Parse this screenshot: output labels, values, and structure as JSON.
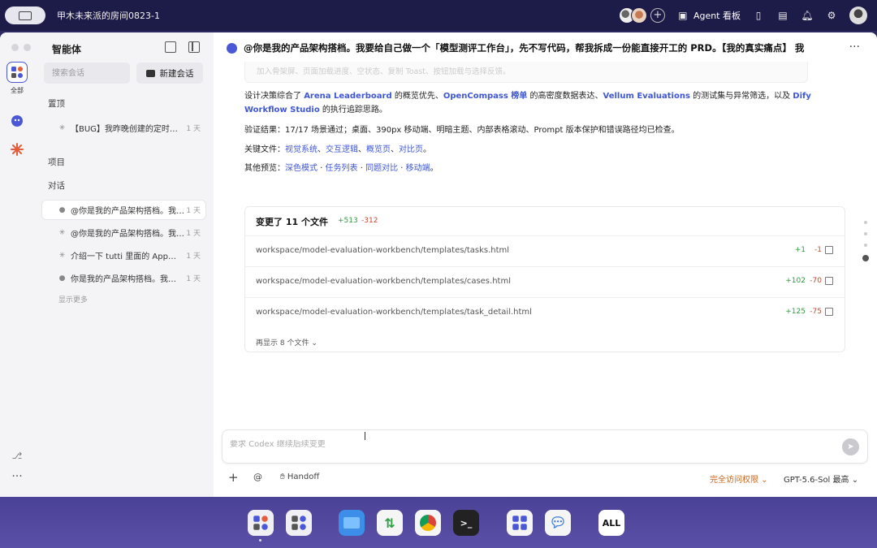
{
  "topbar": {
    "room_title": "甲木未来派的房间0823-1",
    "agent_board": "Agent 看板"
  },
  "sidebar": {
    "title": "智能体",
    "rail_all_label": "全部",
    "search_placeholder": "搜索会话",
    "new_chat": "新建会话",
    "pinned_label": "置顶",
    "pinned": [
      {
        "text": "【BUG】我昨晚创建的定时…",
        "time": "1 天"
      }
    ],
    "projects_label": "项目",
    "chats_label": "对话",
    "chats": [
      {
        "text": "@你是我的产品架构搭档。我…",
        "time": "1 天"
      },
      {
        "text": "@你是我的产品架构搭档。我…",
        "time": "1 天"
      },
      {
        "text": "介绍一下 tutti 里面的 App…",
        "time": "1 天"
      },
      {
        "text": "你是我的产品架构搭档。我…",
        "time": "1 天"
      }
    ],
    "show_more": "显示更多"
  },
  "content": {
    "title": "@你是我的产品架构搭档。我要给自己做一个「模型测评工作台」，先不写代码，帮我拆成一份能直接开工的 PRD。【我的真实痛点】 我",
    "faded_line": "加入骨架屏、页面加载进度、空状态、复制 Toast、按钮加载与选择反馈。",
    "design_note": {
      "prefix": "设计决策综合了 ",
      "l1": "Arena Leaderboard",
      "t1": " 的概览优先、",
      "l2": "OpenCompass 榜单",
      "t2": " 的高密度数据表达、",
      "l3": "Vellum Evaluations",
      "t3": " 的测试集与异常筛选，以及 ",
      "l4": "Dify",
      "l4b": "Workflow Studio",
      "t4": " 的执行追踪思路。"
    },
    "verify": "验证结果：17/17 场景通过；桌面、390px 移动端、明暗主题、内部表格滚动、Prompt 版本保护和错误路径均已检查。",
    "key_files": {
      "label": "关键文件：",
      "items": [
        "视觉系统",
        "交互逻辑",
        "概览页",
        "对比页"
      ],
      "sep": "、",
      "end": "。"
    },
    "previews": {
      "label": "其他预览：",
      "items": [
        "深色模式",
        "任务列表",
        "同题对比",
        "移动端"
      ],
      "sep": " · ",
      "end": "。"
    },
    "files_card": {
      "title": "变更了 11 个文件",
      "added": "+513",
      "removed": "-312",
      "files": [
        {
          "path": "workspace/model-evaluation-workbench/templates/tasks.html",
          "added": "+1",
          "removed": "-1"
        },
        {
          "path": "workspace/model-evaluation-workbench/templates/cases.html",
          "added": "+102",
          "removed": "-70"
        },
        {
          "path": "workspace/model-evaluation-workbench/templates/task_detail.html",
          "added": "+125",
          "removed": "-75"
        }
      ],
      "more": "再显示 8 个文件"
    },
    "composer_placeholder": "要求 Codex 继续后续变更",
    "handoff": "Handoff",
    "access": "完全访问权限",
    "model": "GPT-5.6-Sol 最高"
  },
  "dock": {
    "all_label": "ALL"
  },
  "colors": {
    "accent": "#4b57d9",
    "add": "#2c9a3c",
    "del": "#c4482f",
    "warn": "#c8661e"
  }
}
